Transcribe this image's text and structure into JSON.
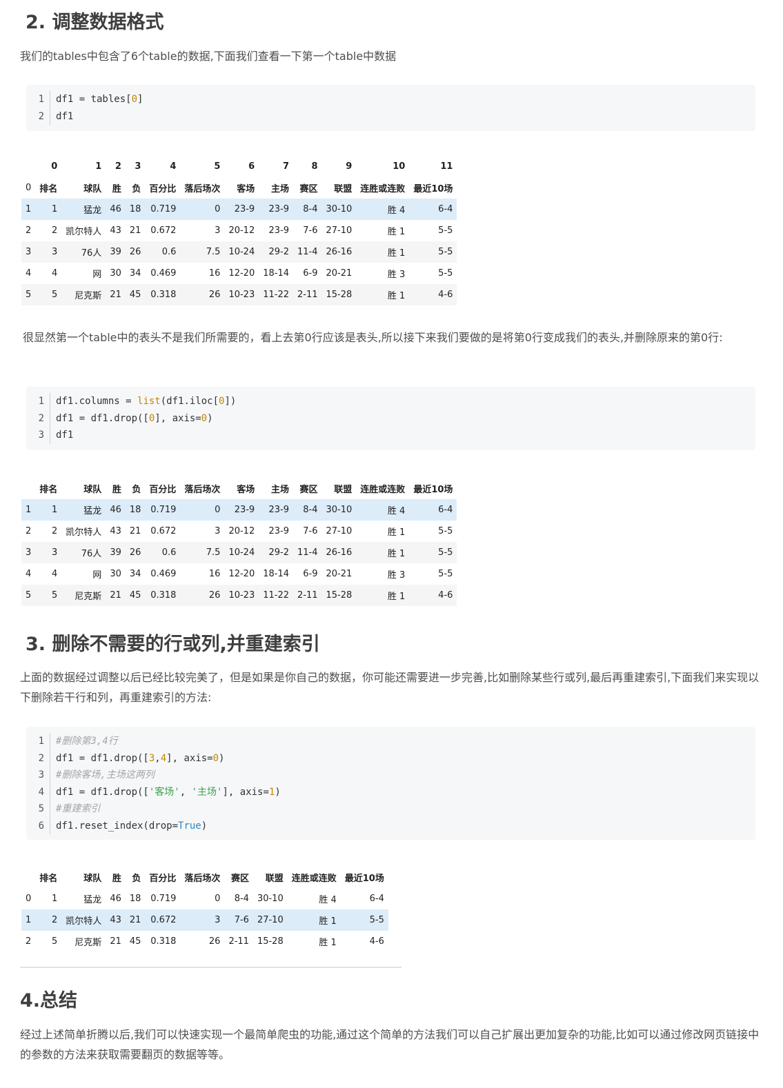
{
  "section2": {
    "heading": "2. 调整数据格式",
    "para": "我们的tables中包含了6个table的数据,下面我们查看一下第一个table中数据"
  },
  "code1": {
    "lines": [
      {
        "n": "1",
        "a": "df1 = tables[",
        "b": "0",
        "c": "]"
      },
      {
        "n": "2",
        "a": "df1"
      }
    ]
  },
  "table1": {
    "header": [
      "",
      "0",
      "1",
      "2",
      "3",
      "4",
      "5",
      "6",
      "7",
      "8",
      "9",
      "10",
      "11"
    ],
    "rows": [
      [
        "0",
        "排名",
        "球队",
        "胜",
        "负",
        "百分比",
        "落后场次",
        "客场",
        "主场",
        "赛区",
        "联盟",
        "连胜或连败",
        "最近10场"
      ],
      [
        "1",
        "1",
        "猛龙",
        "46",
        "18",
        "0.719",
        "0",
        "23-9",
        "23-9",
        "8-4",
        "30-10",
        "胜 4",
        "6-4"
      ],
      [
        "2",
        "2",
        "凯尔特人",
        "43",
        "21",
        "0.672",
        "3",
        "20-12",
        "23-9",
        "7-6",
        "27-10",
        "胜 1",
        "5-5"
      ],
      [
        "3",
        "3",
        "76人",
        "39",
        "26",
        "0.6",
        "7.5",
        "10-24",
        "29-2",
        "11-4",
        "26-16",
        "胜 1",
        "5-5"
      ],
      [
        "4",
        "4",
        "网",
        "30",
        "34",
        "0.469",
        "16",
        "12-20",
        "18-14",
        "6-9",
        "20-21",
        "胜 3",
        "5-5"
      ],
      [
        "5",
        "5",
        "尼克斯",
        "21",
        "45",
        "0.318",
        "26",
        "10-23",
        "11-22",
        "2-11",
        "15-28",
        "胜 1",
        "4-6"
      ]
    ]
  },
  "para2": "很显然第一个table中的表头不是我们所需要的，看上去第0行应该是表头,所以接下来我们要做的是将第0行变成我们的表头,并删除原来的第0行:",
  "code2": {
    "l1a": "df1.columns = ",
    "l1kw": "list",
    "l1b": "(df1.iloc[",
    "l1n": "0",
    "l1c": "])",
    "l2a": "df1 = df1.drop([",
    "l2n1": "0",
    "l2b": "], axis=",
    "l2n2": "0",
    "l2c": ")",
    "l3": "df1"
  },
  "table2": {
    "header": [
      "",
      "排名",
      "球队",
      "胜",
      "负",
      "百分比",
      "落后场次",
      "客场",
      "主场",
      "赛区",
      "联盟",
      "连胜或连败",
      "最近10场"
    ],
    "rows": [
      [
        "1",
        "1",
        "猛龙",
        "46",
        "18",
        "0.719",
        "0",
        "23-9",
        "23-9",
        "8-4",
        "30-10",
        "胜 4",
        "6-4"
      ],
      [
        "2",
        "2",
        "凯尔特人",
        "43",
        "21",
        "0.672",
        "3",
        "20-12",
        "23-9",
        "7-6",
        "27-10",
        "胜 1",
        "5-5"
      ],
      [
        "3",
        "3",
        "76人",
        "39",
        "26",
        "0.6",
        "7.5",
        "10-24",
        "29-2",
        "11-4",
        "26-16",
        "胜 1",
        "5-5"
      ],
      [
        "4",
        "4",
        "网",
        "30",
        "34",
        "0.469",
        "16",
        "12-20",
        "18-14",
        "6-9",
        "20-21",
        "胜 3",
        "5-5"
      ],
      [
        "5",
        "5",
        "尼克斯",
        "21",
        "45",
        "0.318",
        "26",
        "10-23",
        "11-22",
        "2-11",
        "15-28",
        "胜 1",
        "4-6"
      ]
    ]
  },
  "section3": {
    "heading": "3. 删除不需要的行或列,并重建索引",
    "para": "上面的数据经过调整以后已经比较完美了，但是如果是你自己的数据，你可能还需要进一步完善,比如删除某些行或列,最后再重建索引,下面我们来实现以下删除若干行和列，再重建索引的方法:"
  },
  "code3": {
    "c1": "#删除第3,4行",
    "l2a": "df1 = df1.drop([",
    "l2n1": "3",
    "l2s": ",",
    "l2n2": "4",
    "l2b": "], axis=",
    "l2n3": "0",
    "l2c": ")",
    "c3": "#删除客场,主场这两列",
    "l4a": "df1 = df1.drop([",
    "l4s1": "'客场'",
    "l4m": ", ",
    "l4s2": "'主场'",
    "l4b": "], axis=",
    "l4n": "1",
    "l4c": ")",
    "c5": "#重建索引",
    "l6a": "df1.reset_index(drop=",
    "l6bool": "True",
    "l6c": ")"
  },
  "table3": {
    "header": [
      "",
      "排名",
      "球队",
      "胜",
      "负",
      "百分比",
      "落后场次",
      "赛区",
      "联盟",
      "连胜或连败",
      "最近10场"
    ],
    "rows": [
      [
        "0",
        "1",
        "猛龙",
        "46",
        "18",
        "0.719",
        "0",
        "8-4",
        "30-10",
        "胜 4",
        "6-4"
      ],
      [
        "1",
        "2",
        "凯尔特人",
        "43",
        "21",
        "0.672",
        "3",
        "7-6",
        "27-10",
        "胜 1",
        "5-5"
      ],
      [
        "2",
        "5",
        "尼克斯",
        "21",
        "45",
        "0.318",
        "26",
        "2-11",
        "15-28",
        "胜 1",
        "4-6"
      ]
    ]
  },
  "section4": {
    "heading": "4.总结",
    "para": "经过上述简单折腾以后,我们可以快速实现一个最简单爬虫的功能,通过这个简单的方法我们可以自己扩展出更加复杂的功能,比如可以通过修改网页链接中的参数的方法来获取需要翻页的数据等等。"
  }
}
